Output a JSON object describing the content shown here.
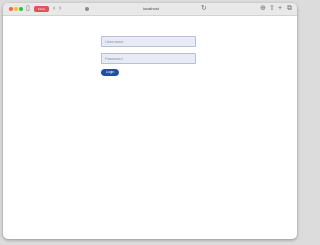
{
  "browser": {
    "tab_label": "Inbox",
    "address": "localhost",
    "colors": {
      "close": "#ff5f57",
      "minimize": "#febc2e",
      "maximize": "#28c840",
      "tab_pill": "#e0525c"
    },
    "icons": {
      "sidebar": "sidebar-icon",
      "back": "back-arrow-icon",
      "forward": "forward-arrow-icon",
      "reload": "reload-icon",
      "shield": "privacy-shield-icon",
      "translate": "translate-icon",
      "share": "share-icon",
      "new_tab": "plus-icon",
      "tab_overview": "tab-overview-icon"
    }
  },
  "form": {
    "username_placeholder": "Username",
    "password_placeholder": "Password",
    "login_label": "Login",
    "colors": {
      "field_bg": "#e8eaf5",
      "button_bg": "#1f4fa3"
    }
  }
}
